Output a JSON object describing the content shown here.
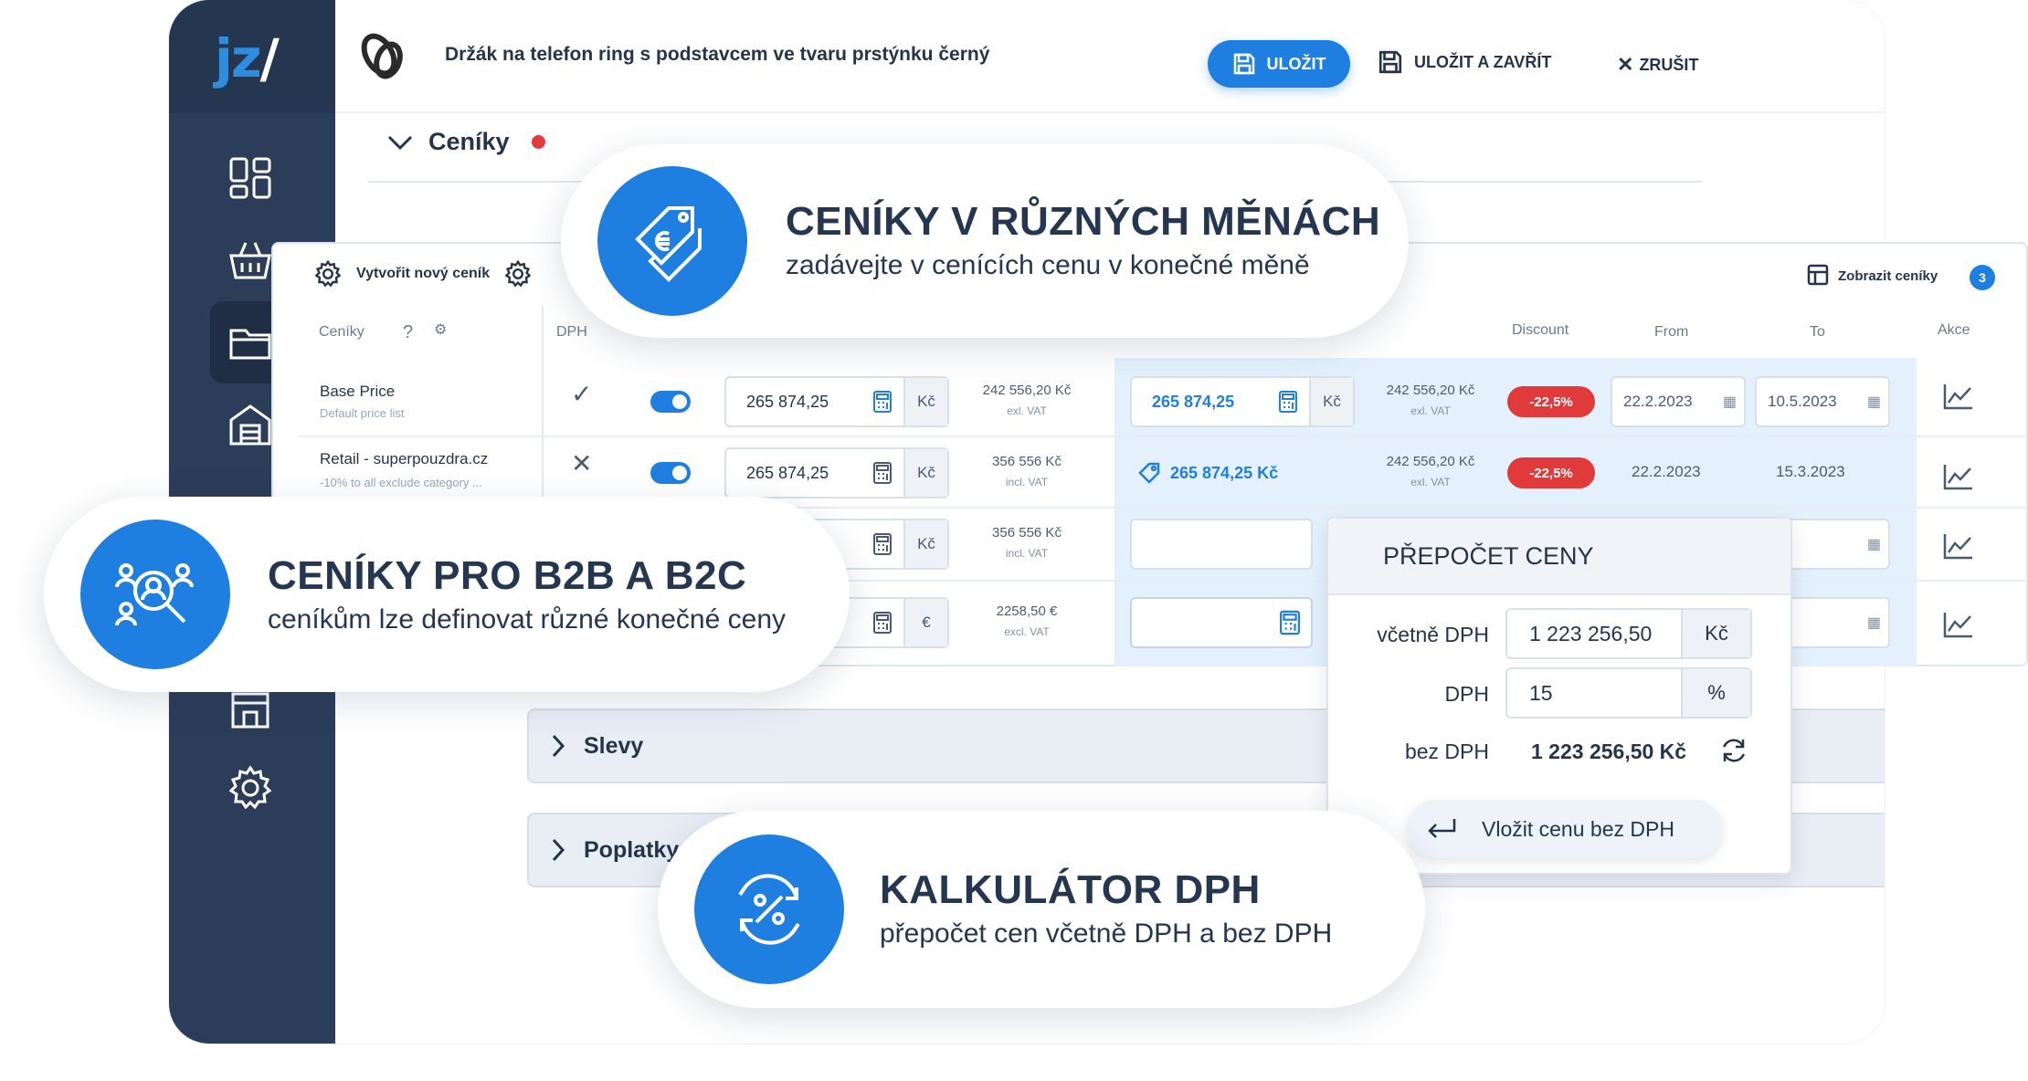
{
  "app": {
    "logo_left": "jz",
    "logo_right": "/"
  },
  "topbar": {
    "product_title": "Držák na telefon ring s podstavcem ve tvaru prstýnku černý",
    "save_label": "ULOŽIT",
    "save_close_label": "ULOŽIT A ZAVŘÍT",
    "cancel_label": "ZRUŠIT"
  },
  "section": {
    "title": "Ceníky"
  },
  "toolbar": {
    "create_label": "Vytvořit nový ceník",
    "show_label": "Zobrazit ceníky",
    "show_count": "3"
  },
  "table": {
    "headers": {
      "list": "Ceníky",
      "vat": "DPH",
      "discount": "Discount",
      "from": "From",
      "to": "To",
      "actions": "Akce"
    },
    "rows": [
      {
        "name": "Base Price",
        "sub": "Default price list",
        "vat": "check",
        "price": "265 874,25",
        "cur": "Kč",
        "amt": "242 556,20 Kč",
        "amt_note": "exl. VAT",
        "final": "265 874,25",
        "final_cur": "Kč",
        "final_amt": "242 556,20 Kč",
        "final_note": "exl. VAT",
        "discount": "-22,5%",
        "from": "22.2.2023",
        "to": "10.5.2023"
      },
      {
        "name": "Retail - superpouzdra.cz",
        "sub": "-10% to all  exclude category ...",
        "vat": "cross",
        "price": "265 874,25",
        "cur": "Kč",
        "amt": "356 556 Kč",
        "amt_note": "incl. VAT",
        "final": "265 874,25 Kč",
        "final_amt": "242 556,20 Kč",
        "final_note": "exl. VAT",
        "discount": "-22,5%",
        "from": "22.2.2023",
        "to": "15.3.2023"
      },
      {
        "cur": "Kč",
        "amt": "356 556 Kč",
        "amt_note": "incl. VAT"
      },
      {
        "cur": "€",
        "amt": "2258,50 €",
        "amt_note": "excl. VAT"
      }
    ]
  },
  "collapsibles": {
    "slevy": "Slevy",
    "poplatky": "Poplatky"
  },
  "calculator": {
    "title": "PŘEPOČET CENY",
    "incl_label": "včetně DPH",
    "incl_value": "1 223 256,50",
    "incl_unit": "Kč",
    "vat_label": "DPH",
    "vat_value": "15",
    "vat_unit": "%",
    "excl_label": "bez DPH",
    "excl_value": "1 223 256,50 Kč",
    "insert_label": "Vložit cenu bez DPH"
  },
  "callouts": {
    "currencies": {
      "title": "CENÍKY V RŮZNÝCH MĚNÁCH",
      "sub": "zadávejte v cenících cenu v konečné měně"
    },
    "b2b": {
      "title": "CENÍKY PRO B2B A B2C",
      "sub": "ceníkům lze definovat různé konečné ceny"
    },
    "vat": {
      "title": "KALKULÁTOR DPH",
      "sub": "přepočet cen včetně DPH a bez DPH"
    }
  }
}
